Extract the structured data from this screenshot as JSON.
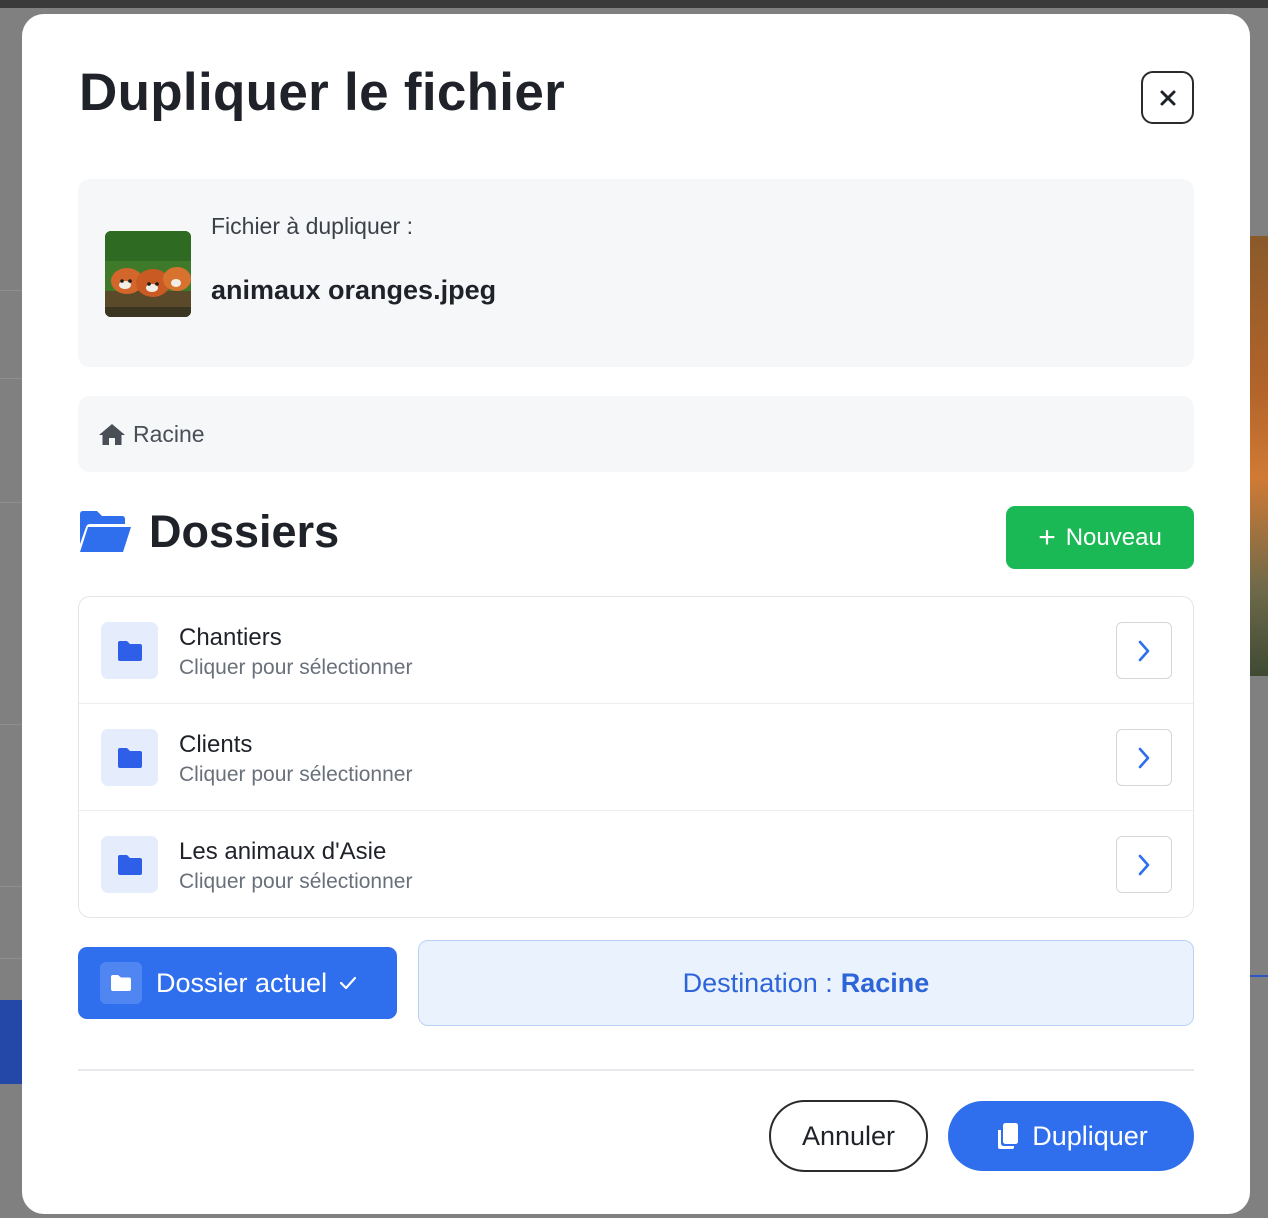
{
  "dialog": {
    "title": "Dupliquer le fichier",
    "close_icon": "close-icon"
  },
  "file": {
    "label": "Fichier à dupliquer :",
    "name": "animaux oranges.jpeg"
  },
  "breadcrumb": {
    "icon": "home-icon",
    "label": "Racine"
  },
  "folders_section": {
    "icon": "folder-open-icon",
    "title": "Dossiers",
    "new_button": {
      "icon": "plus-icon",
      "label": "Nouveau"
    },
    "items": [
      {
        "name": "Chantiers",
        "hint": "Cliquer pour sélectionner"
      },
      {
        "name": "Clients",
        "hint": "Cliquer pour sélectionner"
      },
      {
        "name": "Les animaux d'Asie",
        "hint": "Cliquer pour sélectionner"
      }
    ]
  },
  "current_folder_button": {
    "icon": "folder-icon",
    "label": "Dossier actuel",
    "status_icon": "check-icon"
  },
  "destination": {
    "prefix": "Destination :",
    "value": "Racine"
  },
  "footer": {
    "cancel_label": "Annuler",
    "duplicate_label": "Dupliquer",
    "duplicate_icon": "copy-icon"
  },
  "colors": {
    "primary": "#2f6fee",
    "success": "#1bb955",
    "destination_bg": "#eaf2fd",
    "destination_text": "#2d64d8"
  }
}
